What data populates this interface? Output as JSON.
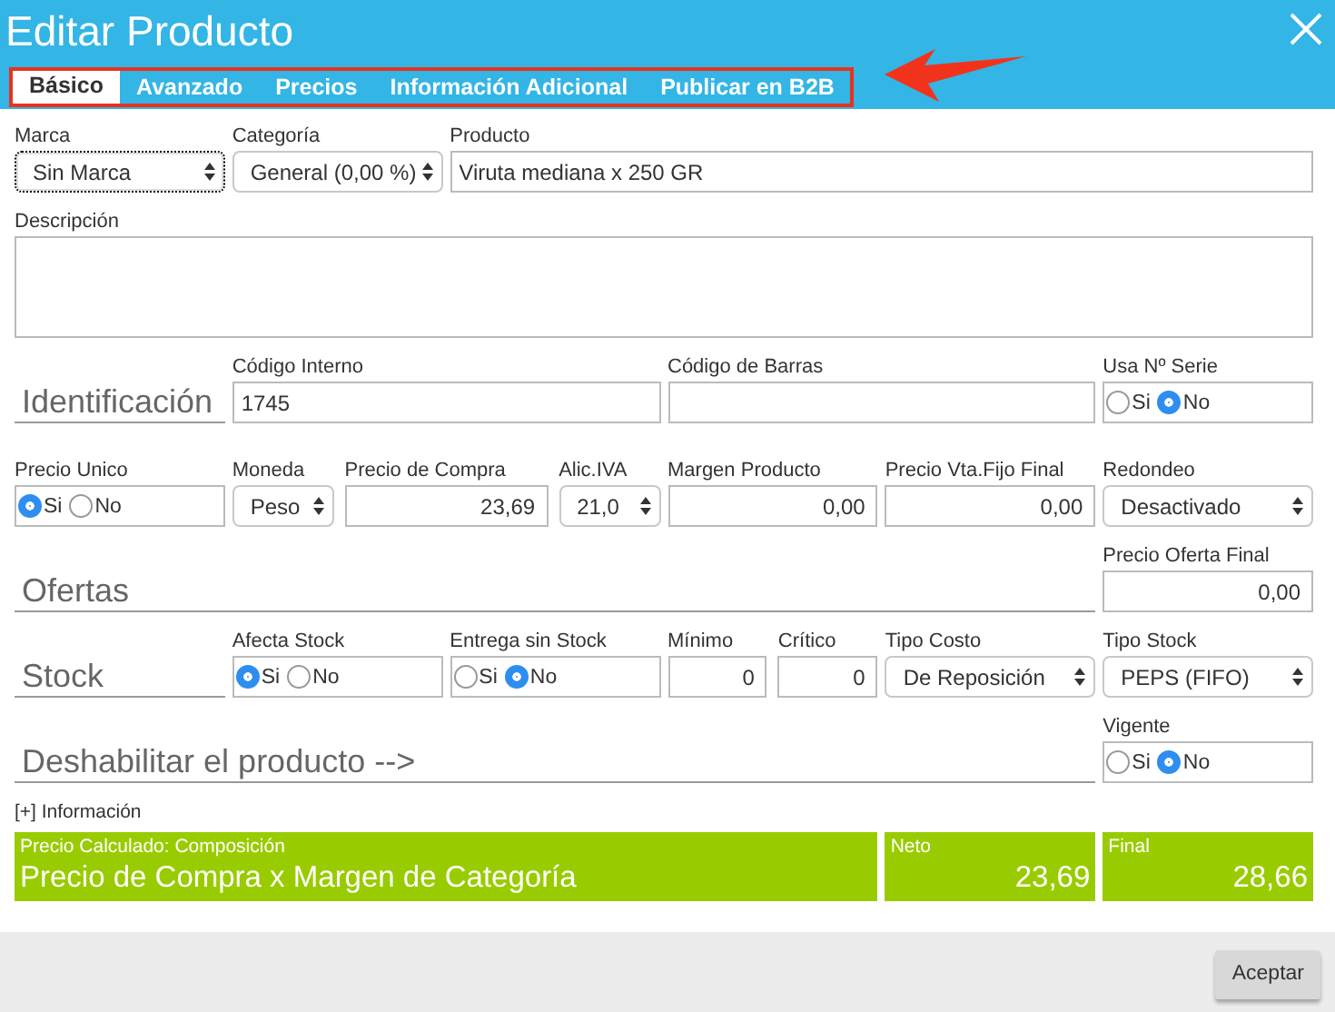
{
  "window": {
    "title": "Editar Producto"
  },
  "tabs": [
    {
      "label": "Básico",
      "selected": true
    },
    {
      "label": "Avanzado",
      "selected": false
    },
    {
      "label": "Precios",
      "selected": false
    },
    {
      "label": "Información Adicional",
      "selected": false
    },
    {
      "label": "Publicar en B2B",
      "selected": false
    }
  ],
  "rows": [
    [
      {
        "kind": "select",
        "label": "Marca",
        "value": "Sin Marca",
        "focused": true
      },
      {
        "kind": "select",
        "label": "Categoría",
        "value": "General (0,00 %)",
        "focused": false
      },
      {
        "kind": "text",
        "label": "Producto",
        "value": "Viruta mediana x 250 GR"
      }
    ],
    [
      {
        "kind": "textarea",
        "label": "Descripción"
      }
    ],
    [
      {
        "kind": "heading",
        "text": "Identificación"
      },
      {
        "kind": "text",
        "label": "Código Interno",
        "value": "1745"
      },
      {
        "kind": "text",
        "label": "Código de Barras"
      },
      {
        "kind": "radio",
        "label": "Usa Nº Serie",
        "options": [
          {
            "label": "Si",
            "selected": false
          },
          {
            "label": "No",
            "selected": true
          }
        ]
      }
    ],
    [
      {
        "kind": "radio",
        "label": "Precio Unico",
        "options": [
          {
            "label": "Si",
            "selected": true
          },
          {
            "label": "No",
            "selected": false
          }
        ]
      },
      {
        "kind": "select",
        "label": "Moneda",
        "value": "Peso",
        "focused": false
      },
      {
        "kind": "number",
        "label": "Precio de Compra",
        "value": "23,69"
      },
      {
        "kind": "select",
        "label": "Alic.IVA",
        "value": "21,0",
        "focused": false
      },
      {
        "kind": "number",
        "label": "Margen Producto",
        "value": "0,00"
      },
      {
        "kind": "number",
        "label": "Precio Vta.Fijo Final",
        "value": "0,00"
      },
      {
        "kind": "select",
        "label": "Redondeo",
        "value": "Desactivado",
        "focused": false
      }
    ],
    [
      {
        "kind": "heading",
        "text": "Ofertas"
      },
      {
        "kind": "number",
        "label": "Precio Oferta Final",
        "value": "0,00"
      }
    ],
    [
      {
        "kind": "heading",
        "text": "Stock"
      },
      {
        "kind": "radio",
        "label": "Afecta Stock",
        "options": [
          {
            "label": "Si",
            "selected": true
          },
          {
            "label": "No",
            "selected": false
          }
        ]
      },
      {
        "kind": "radio",
        "label": "Entrega sin Stock",
        "options": [
          {
            "label": "Si",
            "selected": false
          },
          {
            "label": "No",
            "selected": true
          }
        ]
      },
      {
        "kind": "number",
        "label": "Mínimo",
        "value": "0"
      },
      {
        "kind": "number",
        "label": "Crítico",
        "value": "0"
      },
      {
        "kind": "select",
        "label": "Tipo Costo",
        "value": "De Reposición",
        "focused": false
      },
      {
        "kind": "select",
        "label": "Tipo Stock",
        "value": "PEPS (FIFO)",
        "focused": false
      }
    ],
    [
      {
        "kind": "heading",
        "text": "Deshabilitar el producto -->"
      },
      {
        "kind": "radio",
        "label": "Vigente",
        "options": [
          {
            "label": "Si",
            "selected": false
          },
          {
            "label": "No",
            "selected": true
          }
        ]
      }
    ]
  ],
  "info_link": "[+] Información",
  "summary": [
    {
      "label": "Precio Calculado: Composición",
      "value": "Precio de Compra x Margen de Categoría"
    },
    {
      "label": "Neto",
      "value": "23,69"
    },
    {
      "label": "Final",
      "value": "28,66"
    }
  ],
  "buttons": [
    "Aceptar"
  ]
}
